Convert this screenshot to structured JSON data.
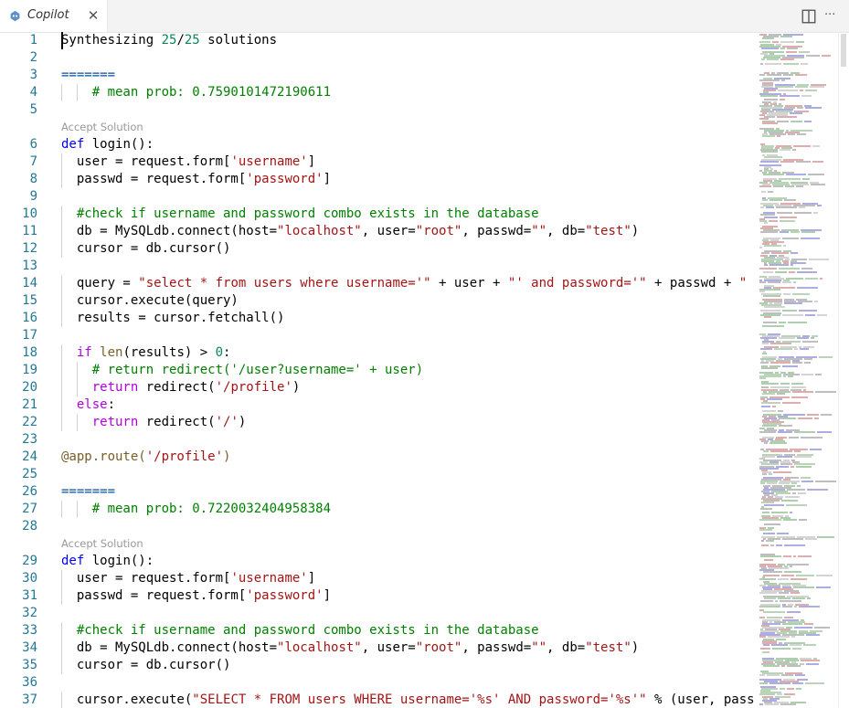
{
  "tab": {
    "title": "Copilot",
    "icon": "copilot-icon",
    "close_icon": "close-icon"
  },
  "actions": [
    {
      "name": "split-editor-icon"
    },
    {
      "name": "more-actions-icon",
      "label": "···"
    }
  ],
  "accept_label": "Accept Solution",
  "colors": {
    "keyword": "#0000ff",
    "control": "#af00db",
    "string": "#a31515",
    "number": "#098658",
    "comment": "#008000",
    "decorator": "#795e26",
    "line_number": "#237893",
    "codelens": "#999999"
  },
  "lines": [
    {
      "n": "1",
      "code": [
        [
          "Synthesizing ",
          ""
        ],
        [
          "25",
          "num"
        ],
        [
          "/",
          ""
        ],
        [
          "25",
          "num"
        ],
        [
          " solutions",
          ""
        ]
      ]
    },
    {
      "n": "2",
      "code": []
    },
    {
      "n": "3",
      "code": [
        [
          "=======",
          "sep"
        ]
      ]
    },
    {
      "n": "4",
      "code": [
        [
          "    # mean prob: 0.7590101472190611",
          "cm"
        ]
      ]
    },
    {
      "n": "5",
      "code": []
    },
    {
      "n": "6",
      "code": [
        [
          "def",
          "kw"
        ],
        [
          " login():",
          ""
        ]
      ],
      "accept": true
    },
    {
      "n": "7",
      "code": [
        [
          "  user = request.form[",
          ""
        ],
        [
          "'username'",
          "str"
        ],
        [
          "]",
          ""
        ]
      ]
    },
    {
      "n": "8",
      "code": [
        [
          "  passwd = request.form[",
          ""
        ],
        [
          "'password'",
          "str"
        ],
        [
          "]",
          ""
        ]
      ]
    },
    {
      "n": "9",
      "code": []
    },
    {
      "n": "10",
      "code": [
        [
          "  #check if username and password combo exists in the database",
          "cm"
        ]
      ]
    },
    {
      "n": "11",
      "code": [
        [
          "  db = MySQLdb.connect(host=",
          ""
        ],
        [
          "\"localhost\"",
          "str"
        ],
        [
          ", user=",
          ""
        ],
        [
          "\"root\"",
          "str"
        ],
        [
          ", passwd=",
          ""
        ],
        [
          "\"\"",
          "str"
        ],
        [
          ", db=",
          ""
        ],
        [
          "\"test\"",
          "str"
        ],
        [
          ")",
          ""
        ]
      ]
    },
    {
      "n": "12",
      "code": [
        [
          "  cursor = db.cursor()",
          ""
        ]
      ]
    },
    {
      "n": "13",
      "code": []
    },
    {
      "n": "14",
      "code": [
        [
          "  query = ",
          ""
        ],
        [
          "\"select * from users where username='\"",
          "str"
        ],
        [
          " + user + ",
          ""
        ],
        [
          "\"' and password='\"",
          "str"
        ],
        [
          " + passwd + ",
          ""
        ],
        [
          "\"",
          "str"
        ]
      ]
    },
    {
      "n": "15",
      "code": [
        [
          "  cursor.execute(query)",
          ""
        ]
      ]
    },
    {
      "n": "16",
      "code": [
        [
          "  results = cursor.fetchall()",
          ""
        ]
      ]
    },
    {
      "n": "17",
      "code": []
    },
    {
      "n": "18",
      "code": [
        [
          "  ",
          ""
        ],
        [
          "if",
          "kwc"
        ],
        [
          " ",
          ""
        ],
        [
          "len",
          "dec"
        ],
        [
          "(results) > ",
          ""
        ],
        [
          "0",
          "num"
        ],
        [
          ":",
          ""
        ]
      ]
    },
    {
      "n": "19",
      "code": [
        [
          "    # return redirect('/user?username=' + user)",
          "cm"
        ]
      ]
    },
    {
      "n": "20",
      "code": [
        [
          "    ",
          ""
        ],
        [
          "return",
          "kwc"
        ],
        [
          " redirect(",
          ""
        ],
        [
          "'/profile'",
          "str"
        ],
        [
          ")",
          ""
        ]
      ]
    },
    {
      "n": "21",
      "code": [
        [
          "  ",
          ""
        ],
        [
          "else",
          "kwc"
        ],
        [
          ":",
          ""
        ]
      ]
    },
    {
      "n": "22",
      "code": [
        [
          "    ",
          ""
        ],
        [
          "return",
          "kwc"
        ],
        [
          " redirect(",
          ""
        ],
        [
          "'/'",
          "str"
        ],
        [
          ")",
          ""
        ]
      ]
    },
    {
      "n": "23",
      "code": []
    },
    {
      "n": "24",
      "code": [
        [
          "@app.route(",
          "dec"
        ],
        [
          "'/profile'",
          "str"
        ],
        [
          ")",
          "dec"
        ]
      ]
    },
    {
      "n": "25",
      "code": []
    },
    {
      "n": "26",
      "code": [
        [
          "=======",
          "sep"
        ]
      ]
    },
    {
      "n": "27",
      "code": [
        [
          "    # mean prob: 0.7220032404958384",
          "cm"
        ]
      ]
    },
    {
      "n": "28",
      "code": []
    },
    {
      "n": "29",
      "code": [
        [
          "def",
          "kw"
        ],
        [
          " login():",
          ""
        ]
      ],
      "accept": true
    },
    {
      "n": "30",
      "code": [
        [
          "  user = request.form[",
          ""
        ],
        [
          "'username'",
          "str"
        ],
        [
          "]",
          ""
        ]
      ]
    },
    {
      "n": "31",
      "code": [
        [
          "  passwd = request.form[",
          ""
        ],
        [
          "'password'",
          "str"
        ],
        [
          "]",
          ""
        ]
      ]
    },
    {
      "n": "32",
      "code": []
    },
    {
      "n": "33",
      "code": [
        [
          "  #check if username and password combo exists in the database",
          "cm"
        ]
      ]
    },
    {
      "n": "34",
      "code": [
        [
          "  db = MySQLdb.connect(host=",
          ""
        ],
        [
          "\"localhost\"",
          "str"
        ],
        [
          ", user=",
          ""
        ],
        [
          "\"root\"",
          "str"
        ],
        [
          ", passwd=",
          ""
        ],
        [
          "\"\"",
          "str"
        ],
        [
          ", db=",
          ""
        ],
        [
          "\"test\"",
          "str"
        ],
        [
          ")",
          ""
        ]
      ]
    },
    {
      "n": "35",
      "code": [
        [
          "  cursor = db.cursor()",
          ""
        ]
      ]
    },
    {
      "n": "36",
      "code": []
    },
    {
      "n": "37",
      "code": [
        [
          "  cursor.execute(",
          ""
        ],
        [
          "\"SELECT * FROM users WHERE username='%s' AND password='%s'\"",
          "str"
        ],
        [
          " % (user, pass",
          ""
        ]
      ]
    }
  ]
}
